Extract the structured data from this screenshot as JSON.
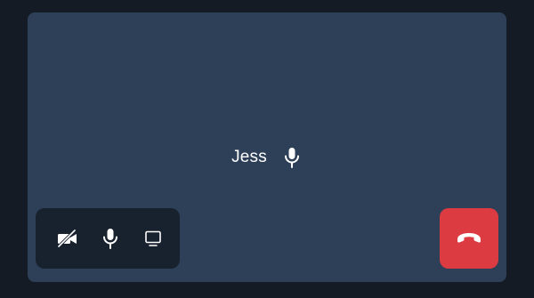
{
  "participant": {
    "name": "Jess",
    "mic_icon": "microphone-icon"
  },
  "controls": {
    "camera_icon": "camera-off-icon",
    "mic_icon": "microphone-icon",
    "screen_share_icon": "screen-share-icon"
  },
  "hangup": {
    "icon": "phone-hangup-icon"
  },
  "colors": {
    "background": "#141b24",
    "stage": "#2e3f58",
    "control_bar": "#18212e",
    "hangup": "#dc3b42",
    "icon": "#ffffff"
  }
}
